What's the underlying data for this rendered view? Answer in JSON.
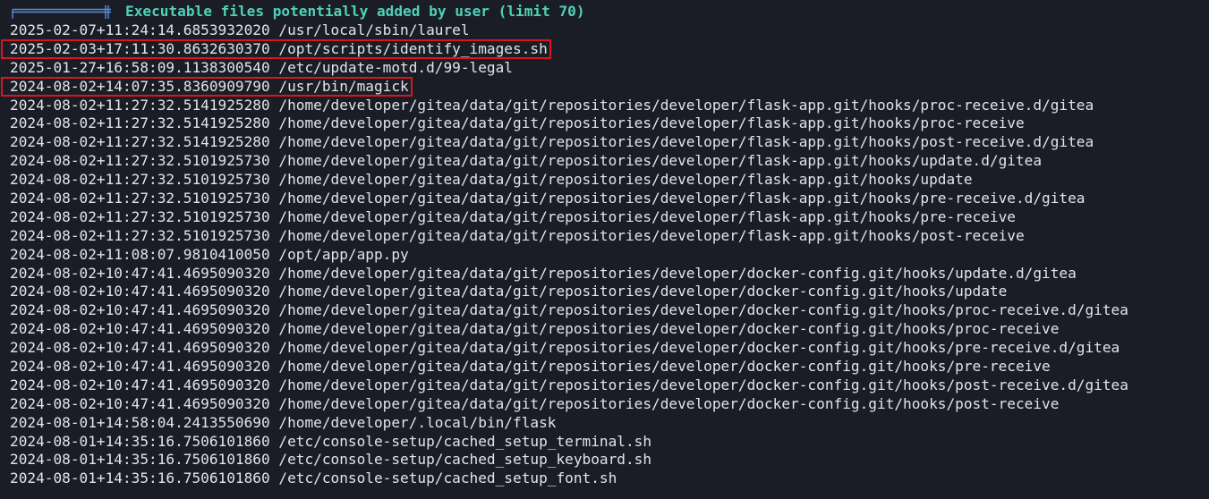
{
  "header": {
    "title": "Executable files potentially added by user (limit 70)"
  },
  "colors": {
    "background": "#1b1d26",
    "text": "#e2e4ec",
    "header": "#4fd1b8",
    "box_art": "#5a8fd6",
    "highlight": "#d9161e"
  },
  "lines": [
    {
      "ts": "2025-02-07+11:24:14.6853932020",
      "path": "/usr/local/sbin/laurel",
      "highlighted": false
    },
    {
      "ts": "2025-02-03+17:11:30.8632630370",
      "path": "/opt/scripts/identify_images.sh",
      "highlighted": true
    },
    {
      "ts": "2025-01-27+16:58:09.1138300540",
      "path": "/etc/update-motd.d/99-legal",
      "highlighted": false
    },
    {
      "ts": "2024-08-02+14:07:35.8360909790",
      "path": "/usr/bin/magick",
      "highlighted": true
    },
    {
      "ts": "2024-08-02+11:27:32.5141925280",
      "path": "/home/developer/gitea/data/git/repositories/developer/flask-app.git/hooks/proc-receive.d/gitea",
      "highlighted": false
    },
    {
      "ts": "2024-08-02+11:27:32.5141925280",
      "path": "/home/developer/gitea/data/git/repositories/developer/flask-app.git/hooks/proc-receive",
      "highlighted": false
    },
    {
      "ts": "2024-08-02+11:27:32.5141925280",
      "path": "/home/developer/gitea/data/git/repositories/developer/flask-app.git/hooks/post-receive.d/gitea",
      "highlighted": false
    },
    {
      "ts": "2024-08-02+11:27:32.5101925730",
      "path": "/home/developer/gitea/data/git/repositories/developer/flask-app.git/hooks/update.d/gitea",
      "highlighted": false
    },
    {
      "ts": "2024-08-02+11:27:32.5101925730",
      "path": "/home/developer/gitea/data/git/repositories/developer/flask-app.git/hooks/update",
      "highlighted": false
    },
    {
      "ts": "2024-08-02+11:27:32.5101925730",
      "path": "/home/developer/gitea/data/git/repositories/developer/flask-app.git/hooks/pre-receive.d/gitea",
      "highlighted": false
    },
    {
      "ts": "2024-08-02+11:27:32.5101925730",
      "path": "/home/developer/gitea/data/git/repositories/developer/flask-app.git/hooks/pre-receive",
      "highlighted": false
    },
    {
      "ts": "2024-08-02+11:27:32.5101925730",
      "path": "/home/developer/gitea/data/git/repositories/developer/flask-app.git/hooks/post-receive",
      "highlighted": false
    },
    {
      "ts": "2024-08-02+11:08:07.9810410050",
      "path": "/opt/app/app.py",
      "highlighted": false
    },
    {
      "ts": "2024-08-02+10:47:41.4695090320",
      "path": "/home/developer/gitea/data/git/repositories/developer/docker-config.git/hooks/update.d/gitea",
      "highlighted": false
    },
    {
      "ts": "2024-08-02+10:47:41.4695090320",
      "path": "/home/developer/gitea/data/git/repositories/developer/docker-config.git/hooks/update",
      "highlighted": false
    },
    {
      "ts": "2024-08-02+10:47:41.4695090320",
      "path": "/home/developer/gitea/data/git/repositories/developer/docker-config.git/hooks/proc-receive.d/gitea",
      "highlighted": false
    },
    {
      "ts": "2024-08-02+10:47:41.4695090320",
      "path": "/home/developer/gitea/data/git/repositories/developer/docker-config.git/hooks/proc-receive",
      "highlighted": false
    },
    {
      "ts": "2024-08-02+10:47:41.4695090320",
      "path": "/home/developer/gitea/data/git/repositories/developer/docker-config.git/hooks/pre-receive.d/gitea",
      "highlighted": false
    },
    {
      "ts": "2024-08-02+10:47:41.4695090320",
      "path": "/home/developer/gitea/data/git/repositories/developer/docker-config.git/hooks/pre-receive",
      "highlighted": false
    },
    {
      "ts": "2024-08-02+10:47:41.4695090320",
      "path": "/home/developer/gitea/data/git/repositories/developer/docker-config.git/hooks/post-receive.d/gitea",
      "highlighted": false
    },
    {
      "ts": "2024-08-02+10:47:41.4695090320",
      "path": "/home/developer/gitea/data/git/repositories/developer/docker-config.git/hooks/post-receive",
      "highlighted": false
    },
    {
      "ts": "2024-08-01+14:58:04.2413550690",
      "path": "/home/developer/.local/bin/flask",
      "highlighted": false
    },
    {
      "ts": "2024-08-01+14:35:16.7506101860",
      "path": "/etc/console-setup/cached_setup_terminal.sh",
      "highlighted": false
    },
    {
      "ts": "2024-08-01+14:35:16.7506101860",
      "path": "/etc/console-setup/cached_setup_keyboard.sh",
      "highlighted": false
    },
    {
      "ts": "2024-08-01+14:35:16.7506101860",
      "path": "/etc/console-setup/cached_setup_font.sh",
      "highlighted": false
    }
  ]
}
